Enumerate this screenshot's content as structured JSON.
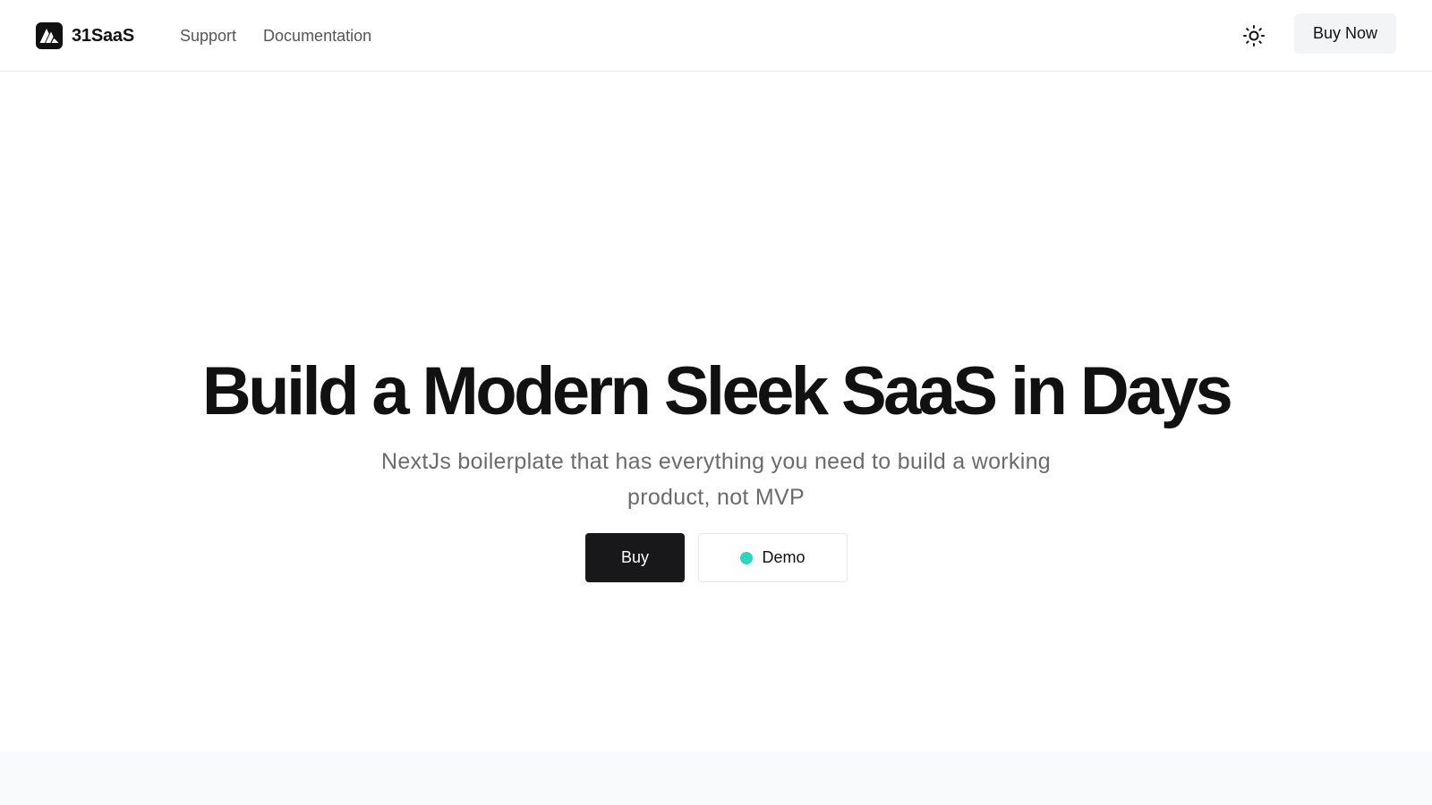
{
  "header": {
    "brand": "31SaaS",
    "logo_icon": "triangle-logo-icon",
    "nav": {
      "support": "Support",
      "documentation": "Documentation"
    },
    "theme_icon": "sun-icon",
    "buy_now": "Buy Now"
  },
  "hero": {
    "title": "Build a Modern Sleek SaaS in Days",
    "subtitle": "NextJs boilerplate that has everything you need to build a working product, not MVP",
    "buy_label": "Buy",
    "demo_label": "Demo",
    "demo_status_color": "#2dd4bf"
  },
  "colors": {
    "primary_button": "#18181b",
    "background": "#ffffff",
    "text": "#111111",
    "muted_text": "#6b6b6b"
  }
}
